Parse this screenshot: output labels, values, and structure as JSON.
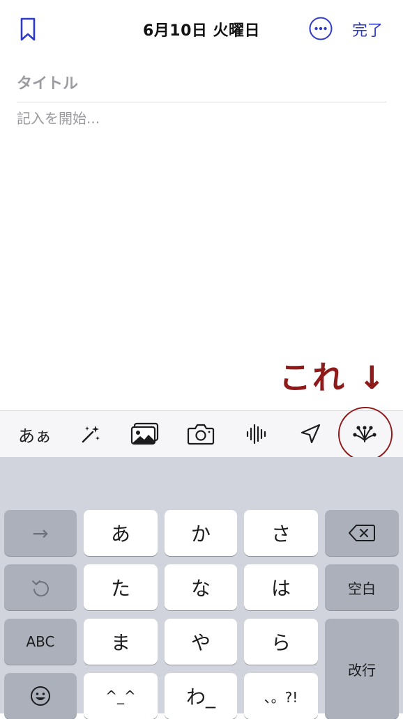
{
  "header": {
    "date_title": "6月10日 火曜日",
    "done_label": "完了"
  },
  "editor": {
    "title_placeholder": "タイトル",
    "body_placeholder": "記入を開始..."
  },
  "annotation": {
    "text": "これ ↓",
    "color": "#8e1a1a"
  },
  "toolbar": {
    "items": [
      {
        "label": "あぁ",
        "icon": "text-format-icon"
      },
      {
        "icon": "magic-wand-icon"
      },
      {
        "icon": "photo-library-icon"
      },
      {
        "icon": "camera-icon"
      },
      {
        "icon": "audio-waveform-icon"
      },
      {
        "icon": "location-arrow-icon"
      },
      {
        "icon": "suggestions-burst-icon"
      }
    ]
  },
  "keyboard": {
    "row1": [
      "→",
      "あ",
      "か",
      "さ"
    ],
    "row2": [
      "た",
      "な",
      "は",
      "空白"
    ],
    "row3": [
      "ABC",
      "ま",
      "や",
      "ら",
      "改行"
    ],
    "row4": [
      "^_^",
      "わ_",
      "、。?!"
    ]
  },
  "colors": {
    "accent": "#2d3ac4",
    "annotation": "#8e1a1a",
    "keyboard_bg": "#d1d4dc"
  }
}
